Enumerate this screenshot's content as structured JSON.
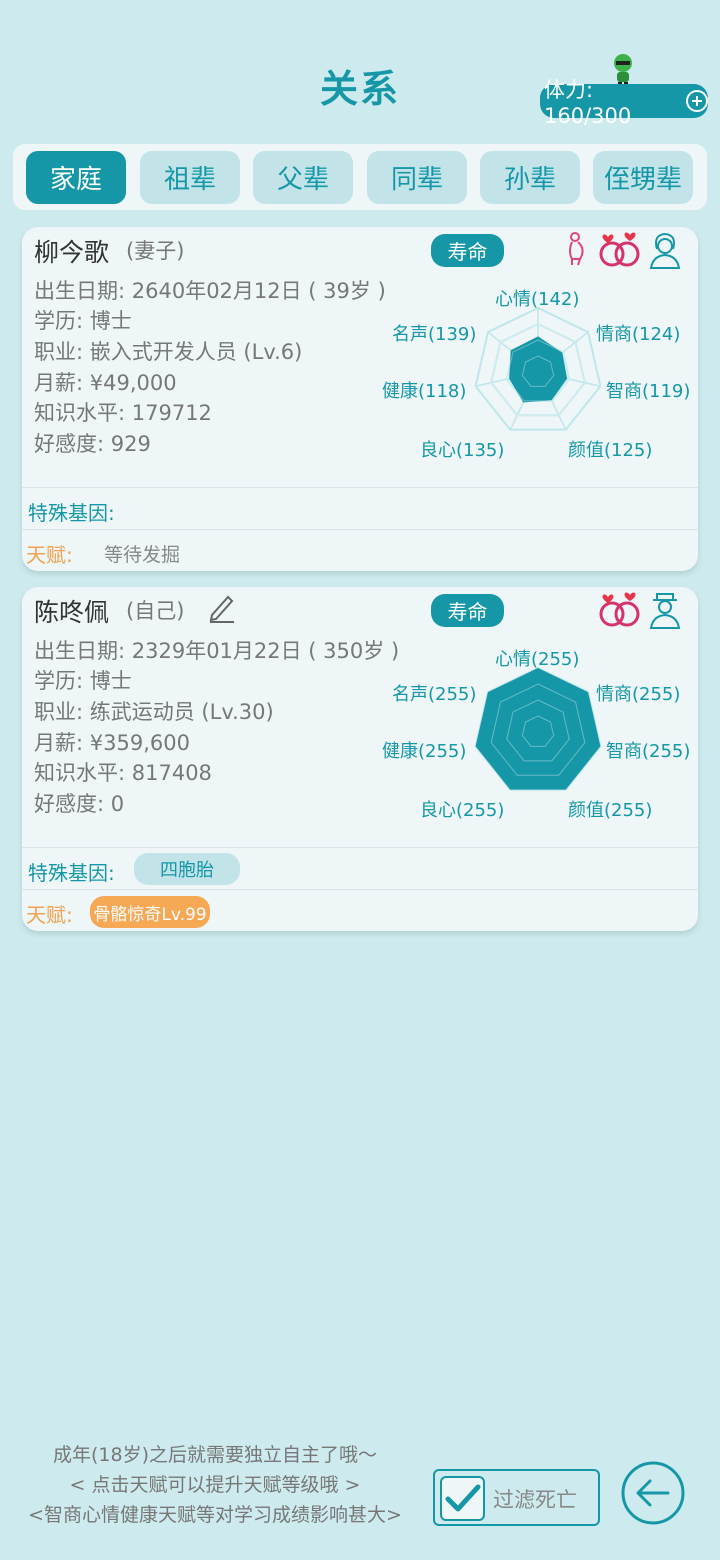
{
  "header": {
    "title": "关系",
    "stamina": "体力: 160/300"
  },
  "tabs": [
    {
      "label": "家庭",
      "active": true
    },
    {
      "label": "祖辈",
      "active": false
    },
    {
      "label": "父辈",
      "active": false
    },
    {
      "label": "同辈",
      "active": false
    },
    {
      "label": "孙辈",
      "active": false
    },
    {
      "label": "侄甥辈",
      "active": false
    }
  ],
  "cards": [
    {
      "name": "柳今歌",
      "role": "(妻子)",
      "life_label": "寿命",
      "birth": "出生日期: 2640年02月12日 ( 39岁 )",
      "education": "学历: 博士",
      "job": "职业: 嵌入式开发人员 (Lv.6)",
      "salary": "月薪: ¥49,000",
      "knowledge": "知识水平: 179712",
      "favor": "好感度: 929",
      "gene_label": "特殊基因:",
      "genes": [],
      "talent_label": "天赋:",
      "talent": "等待发掘",
      "stats": {
        "mood": "心情(142)",
        "eq": "情商(124)",
        "iq": "智商(119)",
        "looks": "颜值(125)",
        "conscience": "良心(135)",
        "health": "健康(118)",
        "fame": "名声(139)"
      },
      "stat_values": [
        142,
        124,
        119,
        125,
        135,
        118,
        139
      ],
      "stat_max": 255
    },
    {
      "name": "陈咚佩",
      "role": "(自己)",
      "life_label": "寿命",
      "birth": "出生日期: 2329年01月22日 ( 350岁 )",
      "education": "学历: 博士",
      "job": "职业: 练武运动员 (Lv.30)",
      "salary": "月薪: ¥359,600",
      "knowledge": "知识水平: 817408",
      "favor": "好感度: 0",
      "gene_label": "特殊基因:",
      "genes": [
        "四胞胎"
      ],
      "talent_label": "天赋:",
      "talent": "骨骼惊奇Lv.99",
      "stats": {
        "mood": "心情(255)",
        "eq": "情商(255)",
        "iq": "智商(255)",
        "looks": "颜值(255)",
        "conscience": "良心(255)",
        "health": "健康(255)",
        "fame": "名声(255)"
      },
      "stat_values": [
        255,
        255,
        255,
        255,
        255,
        255,
        255
      ],
      "stat_max": 255
    }
  ],
  "footer": {
    "tips": [
      "成年(18岁)之后就需要独立自主了哦〜",
      "< 点击天赋可以提升天赋等级哦 >",
      "<智商心情健康天赋等对学习成绩影响甚大>"
    ],
    "filter_label": "过滤死亡",
    "filter_checked": true
  },
  "colors": {
    "accent": "#1597a7",
    "background": "#cdebee",
    "talent": "#f7a855"
  }
}
